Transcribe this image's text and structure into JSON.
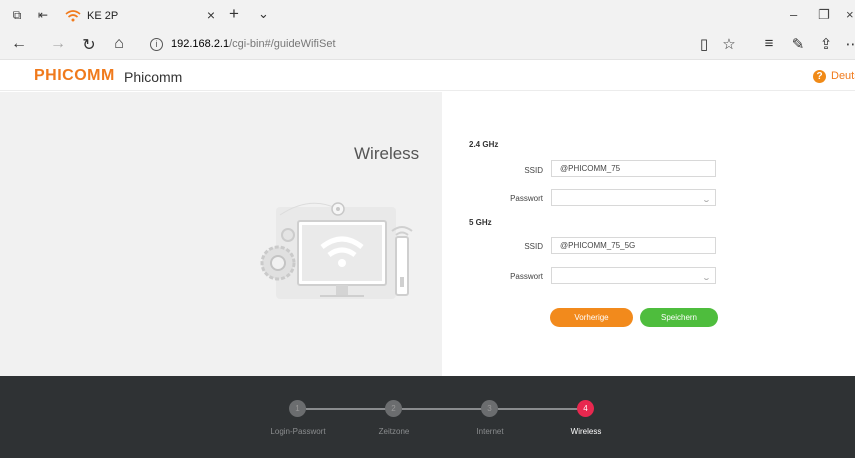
{
  "browser": {
    "tab": {
      "title": "KE 2P"
    },
    "url_host": "192.168.2.1",
    "url_path": "/cgi-bin#/guideWifiSet"
  },
  "brand": {
    "logo": "PHICOMM",
    "name": "Phicomm",
    "help_label": "?",
    "language": "Deutsch"
  },
  "page": {
    "heading": "Wireless"
  },
  "form": {
    "band24": {
      "title": "2.4 GHz",
      "ssid_label": "SSID",
      "ssid_value": "@PHICOMM_75",
      "password_label": "Passwort",
      "password_value": ""
    },
    "band5": {
      "title": "5 GHz",
      "ssid_label": "SSID",
      "ssid_value": "@PHICOMM_75_5G",
      "password_label": "Passwort",
      "password_value": ""
    },
    "prev_button": "Vorherige",
    "save_button": "Speichern"
  },
  "steps": [
    {
      "num": "1",
      "label": "Login-Passwort",
      "active": false
    },
    {
      "num": "2",
      "label": "Zeitzone",
      "active": false
    },
    {
      "num": "3",
      "label": "Internet",
      "active": false
    },
    {
      "num": "4",
      "label": "Wireless",
      "active": true
    }
  ],
  "colors": {
    "brand_orange": "#f07a1c",
    "prev_button": "#f28a1c",
    "save_button": "#4ebd3d",
    "active_step": "#e8284f",
    "footer_bg": "#2f3234"
  }
}
